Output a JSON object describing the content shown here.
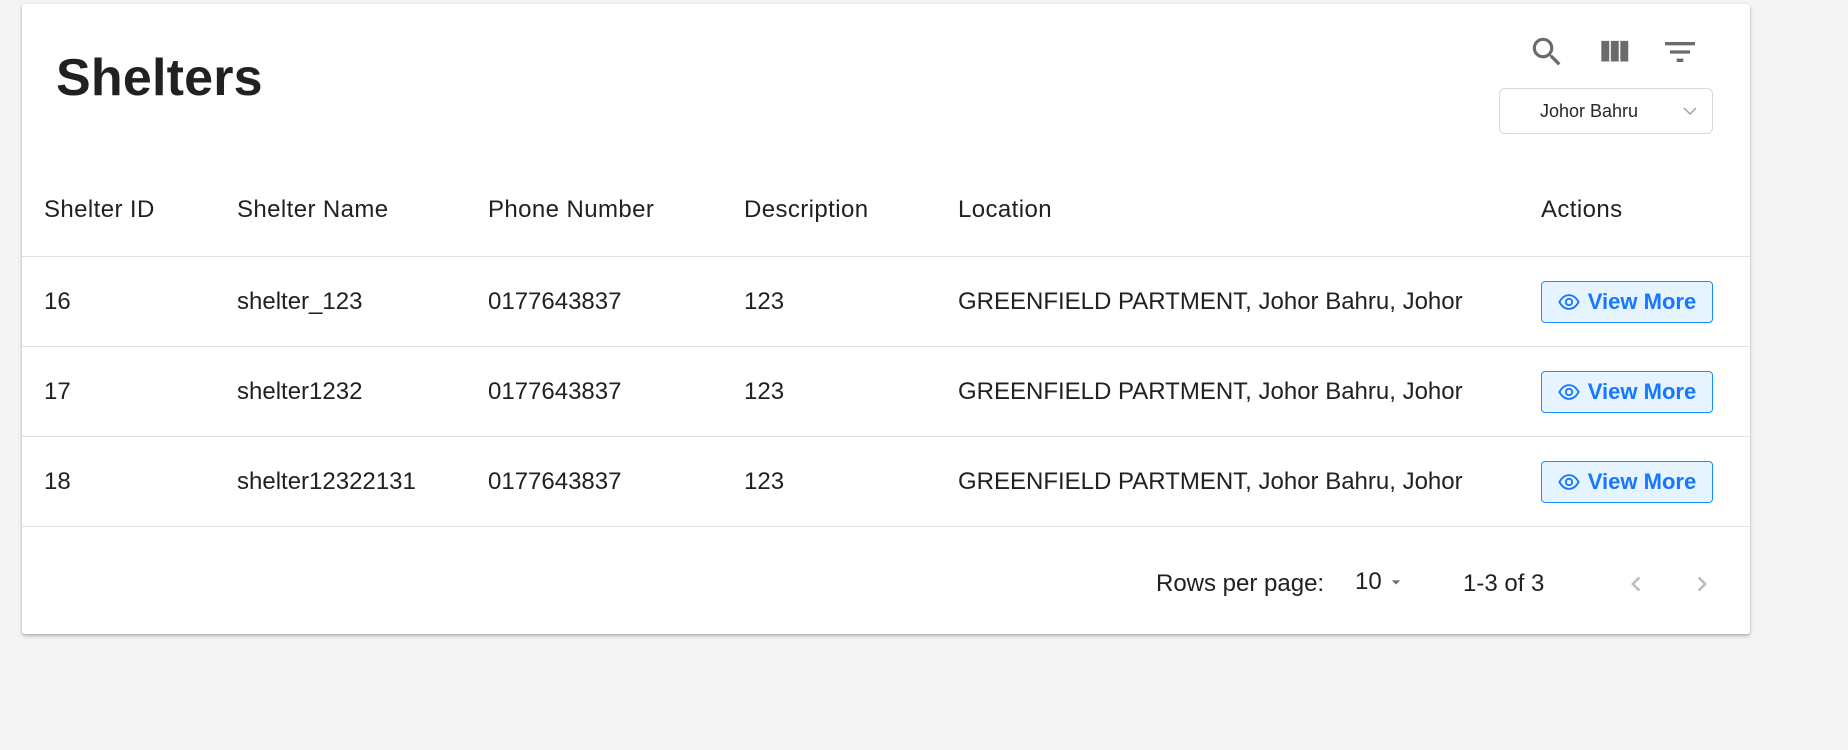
{
  "page": {
    "title": "Shelters"
  },
  "toolbar": {
    "icons": [
      "search-icon",
      "view-columns-icon",
      "filter-icon"
    ],
    "location_select": {
      "value": "Johor Bahru"
    }
  },
  "table": {
    "columns": [
      "Shelter ID",
      "Shelter Name",
      "Phone Number",
      "Description",
      "Location",
      "Actions"
    ],
    "rows": [
      {
        "id": "16",
        "name": "shelter_123",
        "phone": "0177643837",
        "description": "123",
        "location": "GREENFIELD PARTMENT, Johor Bahru, Johor",
        "action": "View More"
      },
      {
        "id": "17",
        "name": "shelter1232",
        "phone": "0177643837",
        "description": "123",
        "location": "GREENFIELD PARTMENT, Johor Bahru, Johor",
        "action": "View More"
      },
      {
        "id": "18",
        "name": "shelter12322131",
        "phone": "0177643837",
        "description": "123",
        "location": "GREENFIELD PARTMENT, Johor Bahru, Johor",
        "action": "View More"
      }
    ]
  },
  "pagination": {
    "rows_per_page_label": "Rows per page:",
    "rows_per_page": "10",
    "range": "1-3 of 3"
  },
  "colors": {
    "accent": "#1677ff",
    "accent_bg": "#e6f4ff",
    "text": "#212121",
    "background": "#f4f4f4"
  }
}
